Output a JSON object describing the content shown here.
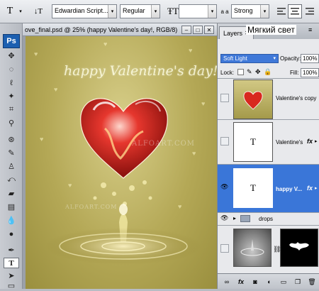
{
  "options_bar": {
    "tool_icon": "type-tool-icon",
    "font_family": "Edwardian Script...",
    "font_style": "Regular",
    "font_size": "",
    "aa_label": "a a",
    "aa_value": "Strong"
  },
  "document": {
    "title": "ove_final.psd @ 25% (happy Valentine's day!, RGB/8)",
    "headline": "happy Valentine's day!",
    "watermark": "ALFOART.COM"
  },
  "tools_panel": {
    "logo": "Ps"
  },
  "layers_panel": {
    "tab_label": "Layers",
    "overlay_label": "Мягкий свет",
    "blend_mode": "Soft Light",
    "opacity_label": "Opacity:",
    "opacity_value": "100%",
    "lock_label": "Lock:",
    "fill_label": "Fill:",
    "fill_value": "100%",
    "layers": [
      {
        "name": "Valentine's copy",
        "fx": "",
        "thumb": ""
      },
      {
        "name": "Valentine's",
        "fx": "fx",
        "thumb": "T"
      },
      {
        "name": "happy V...",
        "fx": "fx",
        "thumb": "T"
      },
      {
        "name": "drops",
        "fx": "",
        "thumb": ""
      },
      {
        "name": "",
        "fx": "",
        "thumb": ""
      }
    ]
  },
  "colors": {
    "active_layer": "#3a76d8",
    "canvas_gold": "#b4a856"
  }
}
